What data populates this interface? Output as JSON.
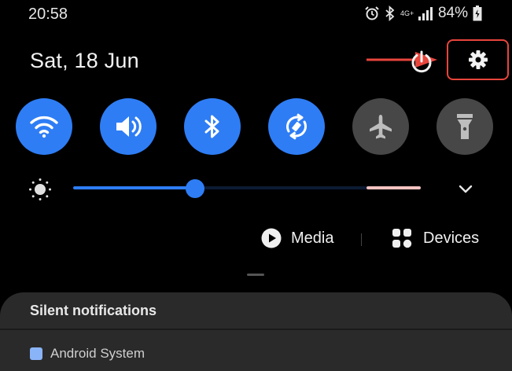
{
  "status_bar": {
    "time": "20:58",
    "network": "4G+",
    "battery": "84%"
  },
  "header": {
    "date": "Sat, 18 Jun"
  },
  "quick_tiles": [
    {
      "name": "wifi",
      "state": "on"
    },
    {
      "name": "sound",
      "state": "on"
    },
    {
      "name": "bluetooth",
      "state": "on"
    },
    {
      "name": "auto-rotate",
      "state": "on"
    },
    {
      "name": "airplane-mode",
      "state": "off"
    },
    {
      "name": "flashlight",
      "state": "off"
    }
  ],
  "brightness": {
    "level": 0.35
  },
  "controls": {
    "media_label": "Media",
    "devices_label": "Devices"
  },
  "notifications": {
    "section_title": "Silent notifications",
    "first_item_label": "Android System"
  },
  "colors": {
    "accent": "#2e7df5",
    "tile_off": "#474747",
    "highlight": "#e8453c",
    "panel": "#2a2a2a"
  }
}
